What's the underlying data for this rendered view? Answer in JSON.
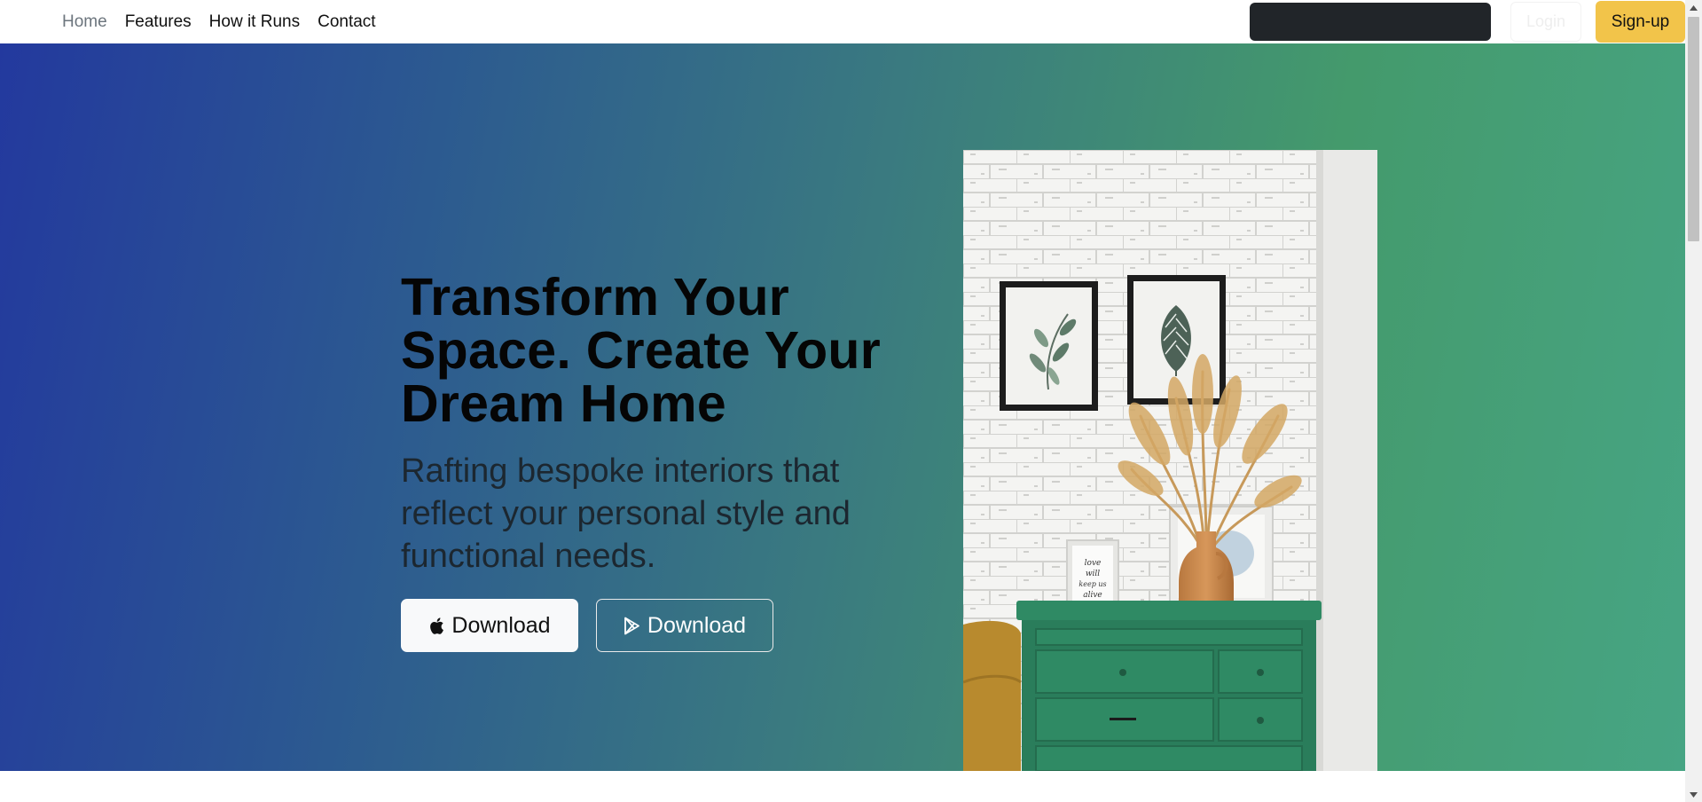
{
  "nav": {
    "links": [
      {
        "label": "Home",
        "active": true
      },
      {
        "label": "Features",
        "active": false
      },
      {
        "label": "How it Runs",
        "active": false
      },
      {
        "label": "Contact",
        "active": false
      }
    ],
    "login_label": "Login",
    "signup_label": "Sign-up"
  },
  "hero": {
    "title": "Transform Your Space. Create Your Dream Home",
    "subtitle": "Rafting bespoke interiors that reflect your personal style and functional needs.",
    "buttons": [
      {
        "label": "Download",
        "icon": "apple-icon",
        "style": "light"
      },
      {
        "label": "Download",
        "icon": "play-store-icon",
        "style": "outline"
      }
    ],
    "image": {
      "alt": "White brick wall with framed botanical prints above a green dresser holding a vase of dried pampas grass",
      "frame_text": "love will keep us alive"
    }
  },
  "colors": {
    "gradient_start": "#23399e",
    "gradient_end": "#47a584",
    "signup_bg": "#f2c44a",
    "search_bg": "#212529",
    "dresser_green": "#2f8a64"
  }
}
